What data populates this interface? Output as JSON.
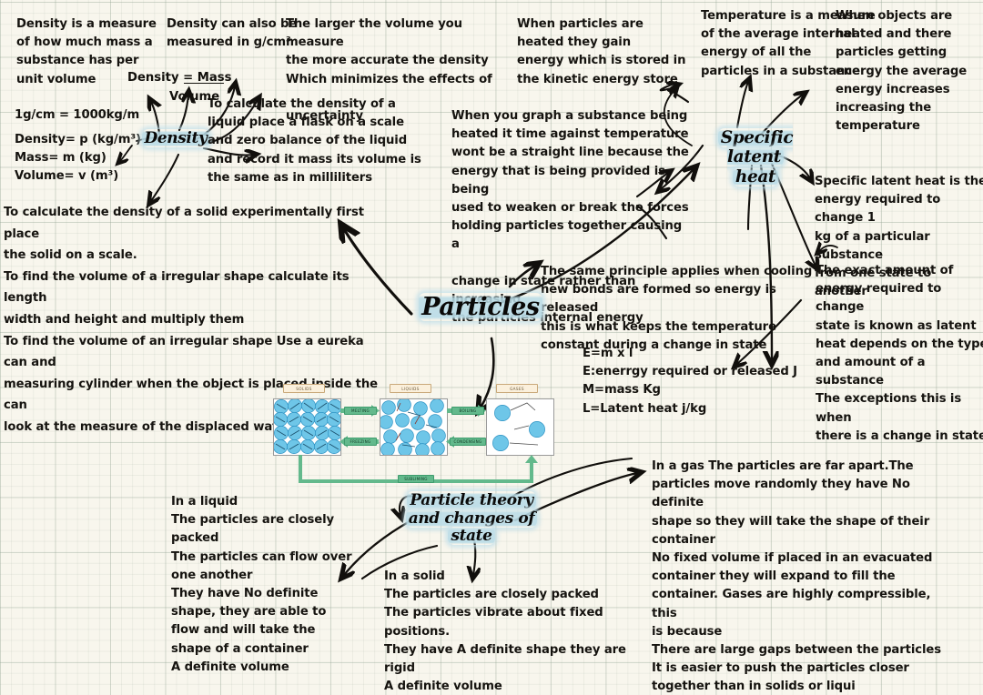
{
  "page": {
    "title": "Particles",
    "paper_color": "#F8F6ED",
    "grid_color": "#8C9E8E",
    "ink_color": "#15130F",
    "highlight_color": "#BADCE7"
  },
  "nodes": {
    "central": "Particles",
    "density": "Density",
    "specific_latent_heat_line1": "Specific latent",
    "specific_latent_heat_line2": "heat",
    "particle_theory_line1": "Particle theory",
    "particle_theory_line2": "and changes of",
    "particle_theory_line3": "state"
  },
  "notes": {
    "density_definition": "Density is a measure\nof how much mass a\nsubstance has per\nunit volume",
    "density_units_line": "1g/cm = 1000kg/m",
    "density_symbols": "Density= p (kg/m³)\nMass= m (kg)\nVolume= v (m³)",
    "density_alt_units": "Density can also be\nmeasured in g/cm³",
    "density_formula_top": "Density = Mass",
    "density_formula_bottom": "Volume",
    "larger_volume": "The larger the volume you measure\nthe more accurate the density\nWhich minimizes the effects of\n\nuncertainty",
    "liquid_density_method": "To calculate the density of a\nliquid place a flask on a scale\nand zero balance of the liquid\nand record it mass its volume is\nthe same as in milliliters",
    "solid_density_method": "To calculate the density of a solid experimentally first place\nthe solid on a scale.\nTo find the volume of a irregular shape calculate its length\nwidth and height and multiply them\nTo find the volume of an irregular shape Use a eureka can and\nmeasuring cylinder when the object is placed inside the can\nlook at the measure of the displaced water.",
    "heated_particles": "When particles are\nheated they gain\nenergy which is stored in\nthe kinetic energy store",
    "graph_heating": "When you graph a substance being\nheated it time against temperature\nwont be a straight line because the\nenergy that is being provided is being\nused to weaken or break the forces\nholding particles together causing a\n\nchange in state rather than increasing\nthe particles internal energy",
    "cooling_principle": "The same principle applies when cooling\nnew bonds are formed so energy is released\nthis is what keeps the temperature\nconstant during a change in state",
    "latent_equation": "E=m x l\nE:enerrgy required or released  J\nM=mass  Kg\nL=Latent heat  j/kg",
    "temperature_definition": "Temperature is a measure\nof the average internal\nenergy of all the\nparticles in a substance",
    "objects_heated": "When objects are\nheated and there\nparticles getting\nenergy the average\nenergy increases\nincreasing the\ntemperature",
    "slh_definition": "Specific latent heat is the\nenergy required to change 1\nkg of a particular substance\nfrom one state to another",
    "exact_amount": "The exact amount of\nenergy required to change\nstate is known as latent\nheat depends on the type\nand amount of a substance\nThe exceptions this is when\nthere is a change in state",
    "in_a_liquid": "In a liquid\n   The particles are closely\n       packed\n   The particles can flow over\n       one another\nThey have  No definite\n       shape, they are able to\n       flow and will take the\n       shape of a container\n   A definite volume",
    "in_a_solid": "   In a solid\nThe particles are closely packed\nThe particles vibrate about fixed positions.\nThey have A definite shape  they are rigid\nA definite volume",
    "in_a_gas": "In a gas The particles are far apart.The\nparticles move randomly they have No definite\nshape so they will take the shape of their\ncontainer\n  No fixed volume if placed in an evacuated\n  container they will expand to fill the\n  container. Gases are highly compressible, this\n  is because\n  There are large gaps between the particles\n  It is easier to push the particles closer\n  together than in solids or liqui"
  },
  "state_diagram": {
    "states": [
      "SOLIDS",
      "LIQUIDS",
      "GASES"
    ],
    "transitions": [
      "MELTING",
      "FREEZING",
      "BOILING",
      "CONDENSING",
      "SUBLIMING"
    ],
    "particle_color": "#6EC6E8",
    "arrow_color": "#63B98C",
    "caption_bg": "#FBF0DC"
  }
}
